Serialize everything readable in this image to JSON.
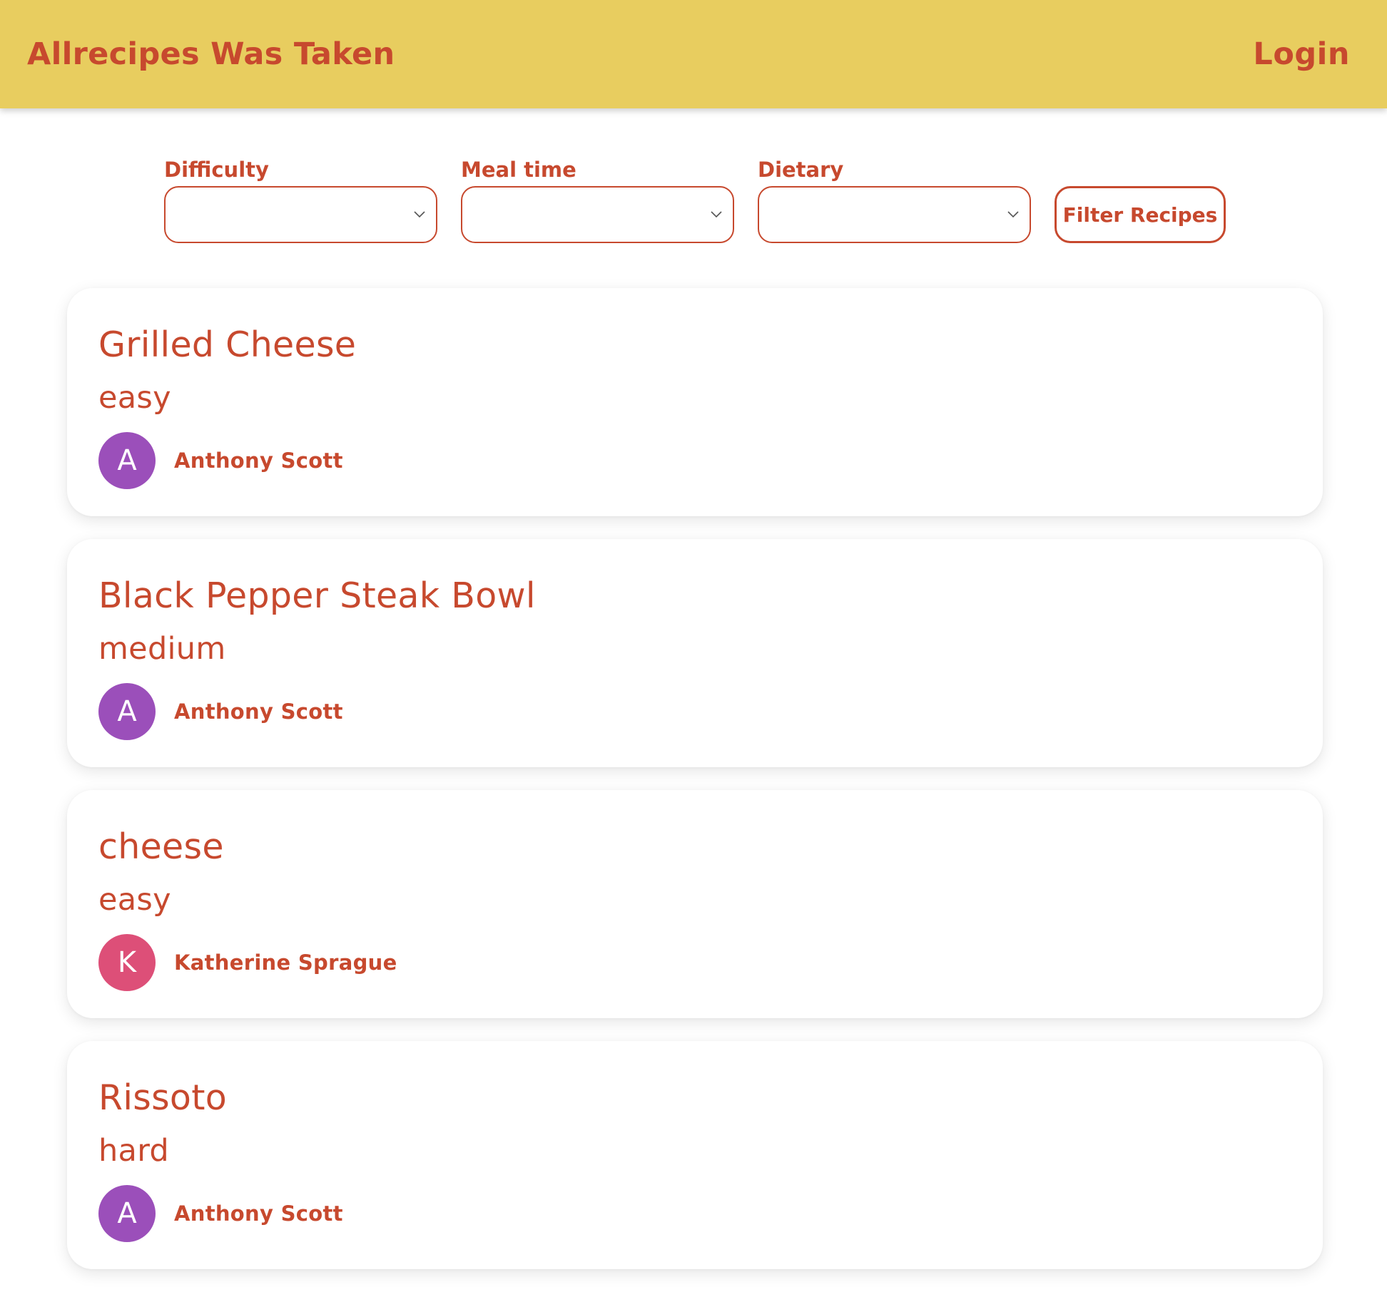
{
  "header": {
    "brand": "Allrecipes Was Taken",
    "login_label": "Login"
  },
  "filters": {
    "difficulty": {
      "label": "Difficulty",
      "value": ""
    },
    "meal_time": {
      "label": "Meal time",
      "value": ""
    },
    "dietary": {
      "label": "Dietary",
      "value": ""
    },
    "submit_label": "Filter Recipes"
  },
  "recipes": [
    {
      "title": "Grilled Cheese",
      "difficulty": "easy",
      "author": {
        "initial": "A",
        "name": "Anthony Scott",
        "avatar_color": "#9b4fba"
      }
    },
    {
      "title": "Black Pepper Steak Bowl",
      "difficulty": "medium",
      "author": {
        "initial": "A",
        "name": "Anthony Scott",
        "avatar_color": "#9b4fba"
      }
    },
    {
      "title": "cheese",
      "difficulty": "easy",
      "author": {
        "initial": "K",
        "name": "Katherine Sprague",
        "avatar_color": "#dd4f78"
      }
    },
    {
      "title": "Rissoto",
      "difficulty": "hard",
      "author": {
        "initial": "A",
        "name": "Anthony Scott",
        "avatar_color": "#9b4fba"
      }
    }
  ],
  "colors": {
    "header_background": "#e8cd5f",
    "accent": "#c7492e"
  },
  "icons": {
    "select_chevron": "chevron-down-icon"
  }
}
